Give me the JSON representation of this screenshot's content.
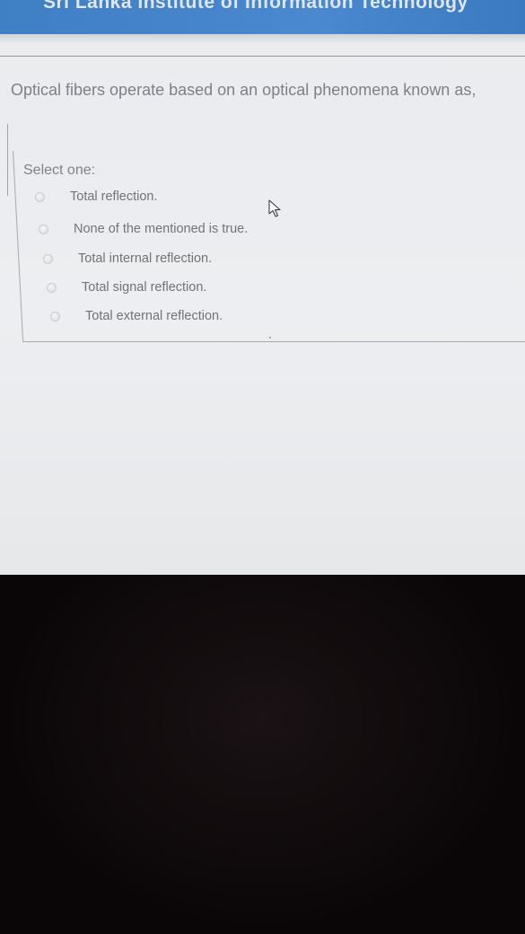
{
  "header": {
    "title": "Sri Lanka Institute of Information Technology"
  },
  "question": {
    "text": "Optical fibers operate based on an optical phenomena known as,",
    "select_label": "Select one:",
    "options": [
      {
        "label": "Total reflection."
      },
      {
        "label": "None of the mentioned is true."
      },
      {
        "label": "Total internal reflection."
      },
      {
        "label": "Total signal reflection."
      },
      {
        "label": "Total external reflection."
      }
    ]
  },
  "colors": {
    "header_blue": "#4a88cf",
    "page_background": "#eceef1"
  }
}
